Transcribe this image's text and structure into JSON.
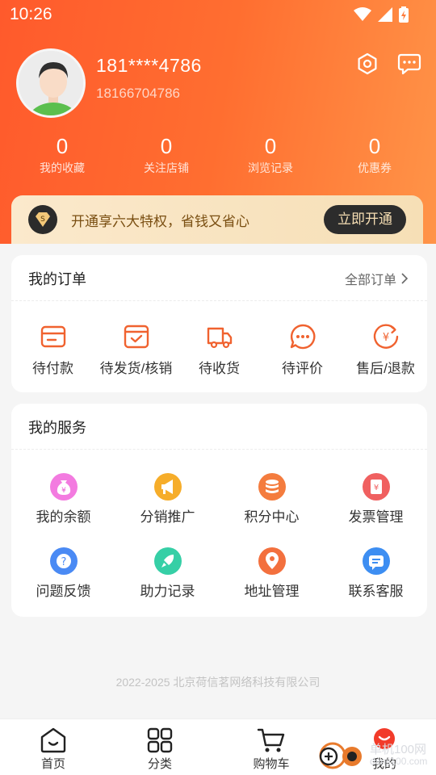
{
  "status": {
    "time": "10:26"
  },
  "profile": {
    "nickname": "181****4786",
    "phone": "18166704786"
  },
  "stats": [
    {
      "num": "0",
      "label": "我的收藏"
    },
    {
      "num": "0",
      "label": "关注店铺"
    },
    {
      "num": "0",
      "label": "浏览记录"
    },
    {
      "num": "0",
      "label": "优惠券"
    }
  ],
  "vip": {
    "text": "开通享六大特权，省钱又省心",
    "button": "立即开通",
    "badge_letter": "S"
  },
  "orders": {
    "title": "我的订单",
    "all_label": "全部订单",
    "items": [
      {
        "label": "待付款",
        "icon": "wallet-icon"
      },
      {
        "label": "待发货/核销",
        "icon": "box-check-icon"
      },
      {
        "label": "待收货",
        "icon": "truck-icon"
      },
      {
        "label": "待评价",
        "icon": "chat-dots-icon"
      },
      {
        "label": "售后/退款",
        "icon": "refund-icon"
      }
    ]
  },
  "services": {
    "title": "我的服务",
    "items": [
      {
        "label": "我的余额",
        "icon": "money-bag-icon",
        "color": "#e65bd2"
      },
      {
        "label": "分销推广",
        "icon": "megaphone-icon",
        "color": "#f5a623"
      },
      {
        "label": "积分中心",
        "icon": "coins-icon",
        "color": "#f07a3a"
      },
      {
        "label": "发票管理",
        "icon": "invoice-icon",
        "color": "#ef5b5b"
      },
      {
        "label": "问题反馈",
        "icon": "question-icon",
        "color": "#3d7ff0"
      },
      {
        "label": "助力记录",
        "icon": "rocket-icon",
        "color": "#2fc8a0"
      },
      {
        "label": "地址管理",
        "icon": "location-icon",
        "color": "#f26a3b"
      },
      {
        "label": "联系客服",
        "icon": "service-chat-icon",
        "color": "#3b8cf0"
      }
    ]
  },
  "footer": {
    "copyright": "2022-2025 北京荷信茗网络科技有限公司"
  },
  "tabbar": [
    {
      "label": "首页",
      "icon": "home-icon"
    },
    {
      "label": "分类",
      "icon": "grid-icon"
    },
    {
      "label": "购物车",
      "icon": "cart-icon"
    },
    {
      "label": "我的",
      "icon": "profile-icon"
    }
  ],
  "watermark": {
    "line1": "单机100网",
    "line2": "danji100.com"
  },
  "colors": {
    "accent": "#ff6a2e",
    "icon_orange": "#f0622f",
    "vip_gold": "#f6deb3"
  }
}
